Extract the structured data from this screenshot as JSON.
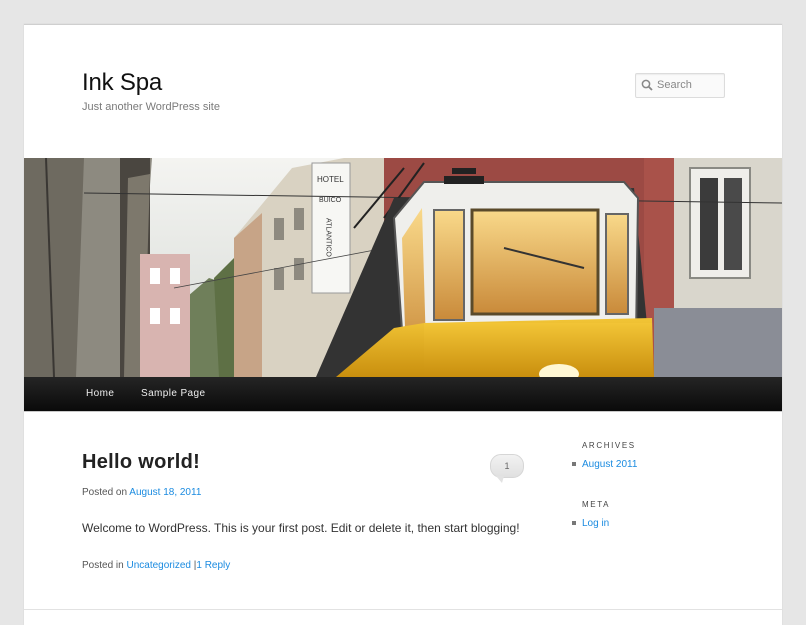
{
  "site": {
    "title": "Ink Spa",
    "description": "Just another WordPress site"
  },
  "search": {
    "placeholder": "Search",
    "icon": "search-icon"
  },
  "nav": {
    "items": [
      {
        "label": "Home"
      },
      {
        "label": "Sample Page"
      }
    ]
  },
  "post": {
    "title": "Hello world!",
    "comment_count": "1",
    "posted_on_prefix": "Posted on",
    "date": "August 18, 2011",
    "body": "Welcome to WordPress. This is your first post. Edit or delete it, then start blogging!",
    "posted_in_prefix": "Posted in",
    "category": "Uncategorized",
    "separator": "|",
    "reply": "1 Reply"
  },
  "sidebar": {
    "archives_title": "ARCHIVES",
    "archives": [
      {
        "label": "August 2011"
      }
    ],
    "meta_title": "META",
    "meta": [
      {
        "label": "Log in"
      }
    ]
  },
  "tram_sign": "HOTEL BUICO ATLANTICO",
  "colors": {
    "link": "#1b8be0",
    "nav_bg": "#111111",
    "tram_yellow": "#e8b21c"
  }
}
